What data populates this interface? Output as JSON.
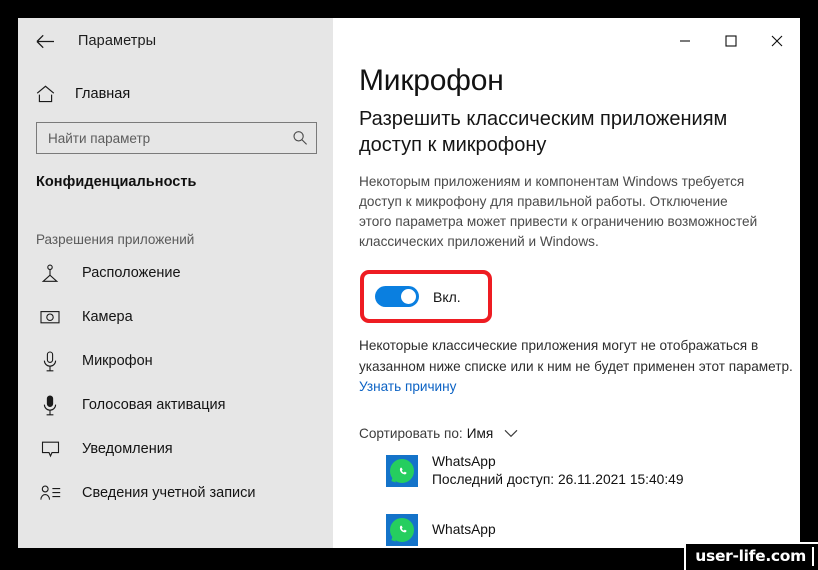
{
  "window": {
    "app_title": "Параметры",
    "back_icon": "back-arrow-icon",
    "controls": {
      "minimize_label": "—",
      "maximize_label": "□",
      "close_label": "✕"
    }
  },
  "sidebar": {
    "home": {
      "label": "Главная",
      "icon": "home-icon"
    },
    "search": {
      "placeholder": "Найти параметр",
      "value": "",
      "icon": "search-icon"
    },
    "section_title": "Конфиденциальность",
    "group_title": "Разрешения приложений",
    "items": [
      {
        "label": "Расположение",
        "icon": "location-icon"
      },
      {
        "label": "Камера",
        "icon": "camera-icon"
      },
      {
        "label": "Микрофон",
        "icon": "microphone-icon"
      },
      {
        "label": "Голосовая активация",
        "icon": "voice-activation-icon"
      },
      {
        "label": "Уведомления",
        "icon": "notifications-icon"
      },
      {
        "label": "Сведения учетной записи",
        "icon": "account-info-icon"
      }
    ]
  },
  "main": {
    "title": "Микрофон",
    "subtitle": "Разрешить классическим приложениям доступ к микрофону",
    "description": "Некоторым приложениям и компонентам Windows требуется доступ к микрофону для правильной работы. Отключение этого параметра может привести к ограничению возможностей классических приложений и Windows.",
    "toggle": {
      "state_label": "Вкл.",
      "checked": true,
      "accent_color": "#0a7fe0",
      "highlight_color": "#ee1c22"
    },
    "note_text": "Некоторые классические приложения могут не отображаться в указанном ниже списке или к ним не будет применен этот параметр. ",
    "note_link": "Узнать причину",
    "sort": {
      "label": "Сортировать по:",
      "value": "Имя",
      "icon": "chevron-down-icon"
    },
    "apps": [
      {
        "name": "WhatsApp",
        "last_access": "Последний доступ: 26.11.2021 15:40:49",
        "icon": "whatsapp-icon"
      },
      {
        "name": "WhatsApp",
        "last_access": "",
        "icon": "whatsapp-icon"
      }
    ]
  },
  "watermark": {
    "text": "user-life.com"
  }
}
